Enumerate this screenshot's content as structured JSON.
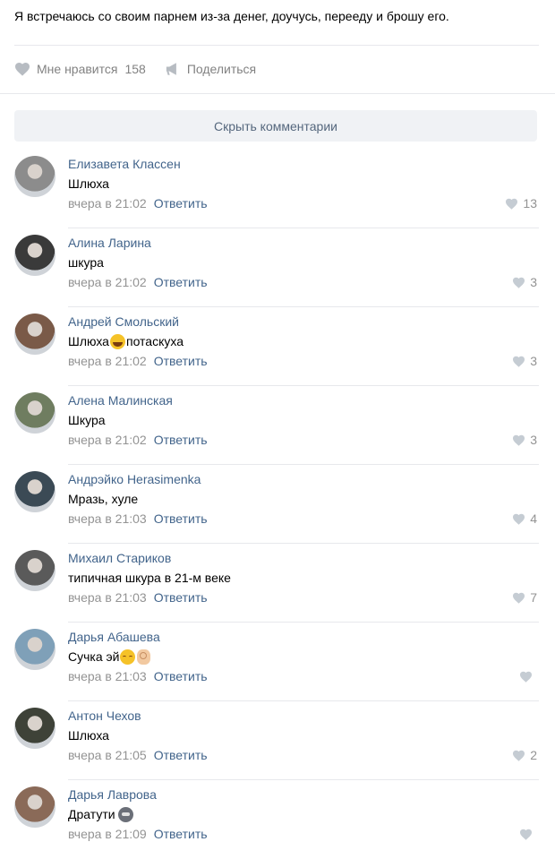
{
  "post": {
    "text": "Я встречаюсь со своим парнем из-за денег, доучусь, перееду и брошу его.",
    "like_label": "Мне нравится",
    "like_count": "158",
    "share_label": "Поделиться"
  },
  "hide_comments_label": "Скрыть комментарии",
  "reply_label": "Ответить",
  "colors": {
    "link": "#42648b",
    "meta": "#939393",
    "button_bg": "#f0f2f5"
  },
  "comments": [
    {
      "author": "Елизавета Классен",
      "text": "Шлюха",
      "time": "вчера в 21:02",
      "likes": "13",
      "avatar_color": "#8c8c8c"
    },
    {
      "author": "Алина Ларина",
      "text": "шкура",
      "time": "вчера в 21:02",
      "likes": "3",
      "avatar_color": "#3a3a3a"
    },
    {
      "author": "Андрей Смольский",
      "text": "Шлюха",
      "text_after": "потаскуха",
      "time": "вчера в 21:02",
      "likes": "3",
      "avatar_color": "#7a5a48"
    },
    {
      "author": "Алена Малинская",
      "text": "Шкура",
      "time": "вчера в 21:02",
      "likes": "3",
      "avatar_color": "#6f7d60"
    },
    {
      "author": "Андрэйко Herasimenka",
      "text": "Мразь, хуле",
      "time": "вчера в 21:03",
      "likes": "4",
      "avatar_color": "#3b4a55"
    },
    {
      "author": "Михаил Стариков",
      "text": "типичная шкура в 21-м веке",
      "time": "вчера в 21:03",
      "likes": "7",
      "avatar_color": "#5a5a5a"
    },
    {
      "author": "Дарья Абашева",
      "text": "Сучка эй",
      "time": "вчера в 21:03",
      "likes": "",
      "avatar_color": "#7fa0b8"
    },
    {
      "author": "Антон Чехов",
      "text": "Шлюха",
      "time": "вчера в 21:05",
      "likes": "2",
      "avatar_color": "#3e4238"
    },
    {
      "author": "Дарья Лаврова",
      "text": "Дратути",
      "time": "вчера в 21:09",
      "likes": "",
      "avatar_color": "#8a6a58"
    }
  ]
}
